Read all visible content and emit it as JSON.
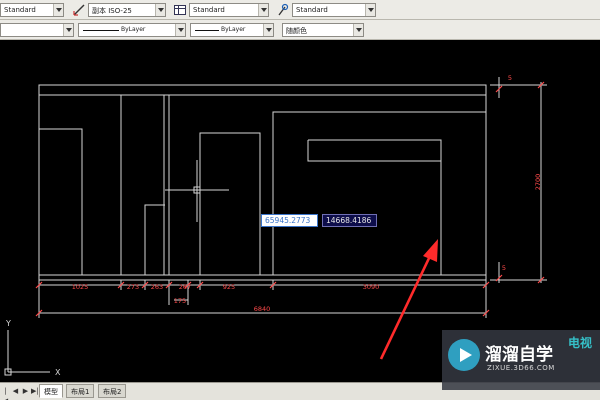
{
  "toolbar": {
    "text_style": "Standard",
    "dim_style": "副本 ISO-25",
    "table_style": "Standard",
    "multileader_style": "Standard",
    "layer": "",
    "linetype": "ByLayer",
    "lineweight": "ByLayer",
    "plot_color": "随颜色"
  },
  "drawing": {
    "dimensions_bottom": [
      "1025",
      "273",
      "263",
      "267",
      "925",
      "3090"
    ],
    "dimension_below": "175",
    "dimension_total": "6840",
    "dimension_height": "2700",
    "marker_top": "5",
    "marker_bottom": "5",
    "axis_y": "Y",
    "axis_x": "X",
    "accent_color": "#ff4a4a",
    "line_color": "#d6d6d6"
  },
  "coord_input": {
    "x": "65945.2773",
    "y": "14668.4186"
  },
  "tabs": {
    "model": "模型",
    "layout1": "布局1",
    "layout2": "布局2"
  },
  "watermark": {
    "title": "溜溜自学",
    "url": "ZIXUE.3D66.COM",
    "side_label": "电视"
  }
}
